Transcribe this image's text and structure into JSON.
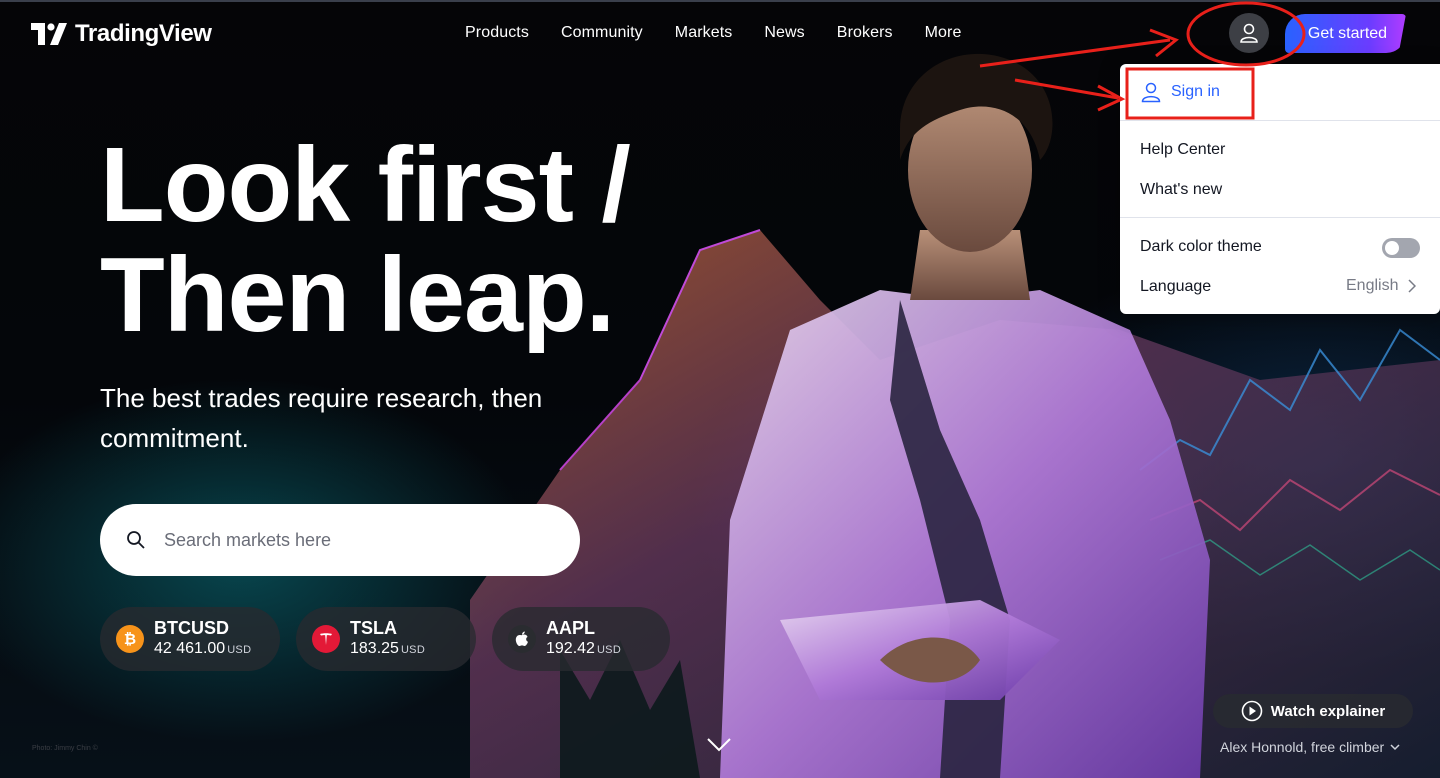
{
  "brand": {
    "name": "TradingView"
  },
  "nav": {
    "items": [
      {
        "label": "Products"
      },
      {
        "label": "Community"
      },
      {
        "label": "Markets"
      },
      {
        "label": "News"
      },
      {
        "label": "Brokers"
      },
      {
        "label": "More"
      }
    ]
  },
  "header": {
    "get_started_label": "Get started",
    "user_icon": "user-icon"
  },
  "dropdown": {
    "sign_in": "Sign in",
    "help_center": "Help Center",
    "whats_new": "What's new",
    "dark_theme": "Dark color theme",
    "dark_theme_enabled": false,
    "language_label": "Language",
    "language_value": "English"
  },
  "hero": {
    "headline_line1": "Look first /",
    "headline_line2": "Then leap.",
    "subtitle": "The best trades require research, then commitment.",
    "search_placeholder": "Search markets here"
  },
  "tickers": [
    {
      "symbol": "BTCUSD",
      "price": "42 461.00",
      "currency": "USD",
      "icon": "bitcoin-icon",
      "color": "#f7931a"
    },
    {
      "symbol": "TSLA",
      "price": "183.25",
      "currency": "USD",
      "icon": "tesla-icon",
      "color": "#e31937"
    },
    {
      "symbol": "AAPL",
      "price": "192.42",
      "currency": "USD",
      "icon": "apple-icon",
      "color": "#2a2c30"
    }
  ],
  "footer": {
    "watch_label": "Watch explainer",
    "caption": "Alex Honnold, free climber",
    "photo_credit": "Photo: Jimmy Chin ©"
  },
  "colors": {
    "accent": "#2962ff",
    "annotation": "#e8201a"
  }
}
